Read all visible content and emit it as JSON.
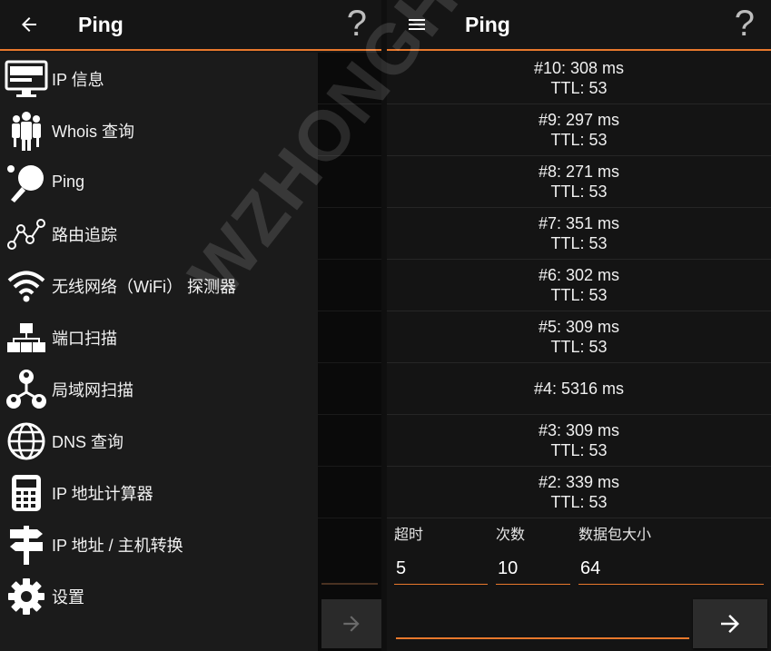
{
  "left": {
    "appbar": {
      "title": "Ping",
      "help": "?"
    },
    "drawer": {
      "items": [
        {
          "label": "IP 信息",
          "icon": "monitor-icon"
        },
        {
          "label": "Whois 查询",
          "icon": "people-icon"
        },
        {
          "label": "Ping",
          "icon": "ping-pong-icon"
        },
        {
          "label": "路由追踪",
          "icon": "route-nodes-icon"
        },
        {
          "label": "无线网络（WiFi） 探测器",
          "icon": "wifi-icon"
        },
        {
          "label": "端口扫描",
          "icon": "network-tree-icon"
        },
        {
          "label": "局域网扫描",
          "icon": "lan-users-icon"
        },
        {
          "label": "DNS 查询",
          "icon": "globe-icon"
        },
        {
          "label": "IP 地址计算器",
          "icon": "calculator-icon"
        },
        {
          "label": "IP 地址 / 主机转换",
          "icon": "signpost-icon"
        },
        {
          "label": "设置",
          "icon": "gear-icon"
        }
      ]
    }
  },
  "right": {
    "appbar": {
      "title": "Ping",
      "help": "?"
    },
    "results": [
      {
        "line1": "#10: 308 ms",
        "line2": "TTL: 53"
      },
      {
        "line1": "#9: 297 ms",
        "line2": "TTL: 53"
      },
      {
        "line1": "#8: 271 ms",
        "line2": "TTL: 53"
      },
      {
        "line1": "#7: 351 ms",
        "line2": "TTL: 53"
      },
      {
        "line1": "#6: 302 ms",
        "line2": "TTL: 53"
      },
      {
        "line1": "#5: 309 ms",
        "line2": "TTL: 53"
      },
      {
        "line1": "#4: 5316 ms",
        "line2": ""
      },
      {
        "line1": "#3: 309 ms",
        "line2": "TTL: 53"
      },
      {
        "line1": "#2: 339 ms",
        "line2": "TTL: 53"
      }
    ],
    "form": {
      "timeout": {
        "label": "超时",
        "value": "5"
      },
      "count": {
        "label": "次数",
        "value": "10"
      },
      "packet_size": {
        "label": "数据包大小",
        "value": "64"
      },
      "host": {
        "value": ""
      }
    }
  },
  "watermark": "WZHONGHE.COM",
  "colors": {
    "accent": "#e8782c",
    "background": "#141414",
    "drawer": "#1b1b1b"
  }
}
